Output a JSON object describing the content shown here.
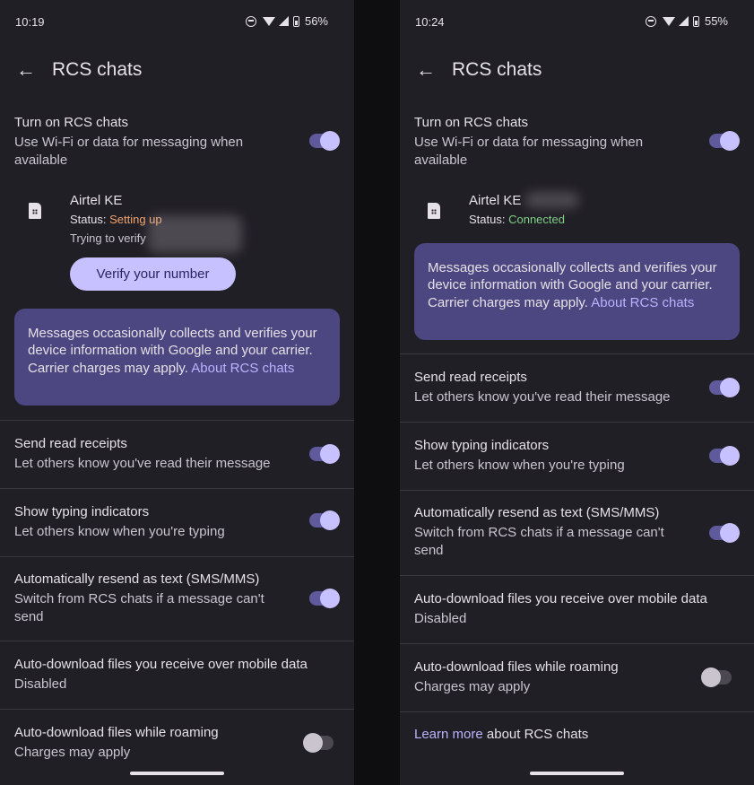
{
  "left": {
    "status_time": "10:19",
    "battery": "56%",
    "header_title": "RCS chats",
    "turn_on": {
      "title": "Turn on RCS chats",
      "subtitle": "Use Wi-Fi or data for messaging when available",
      "enabled": true
    },
    "sim": {
      "carrier": "Airtel KE",
      "status_label": "Status:",
      "status_value": "Setting up",
      "trying": "Trying to verify"
    },
    "verify_button": "Verify your number",
    "info": {
      "text": "Messages occasionally collects and verifies your device information with Google and your carrier. Carrier charges may apply.",
      "link": "About RCS chats"
    },
    "settings": [
      {
        "title": "Send read receipts",
        "subtitle": "Let others know you've read their message",
        "enabled": true
      },
      {
        "title": "Show typing indicators",
        "subtitle": "Let others know when you're typing",
        "enabled": true
      },
      {
        "title": "Automatically resend as text (SMS/MMS)",
        "subtitle": "Switch from RCS chats if a message can't send",
        "enabled": true
      },
      {
        "title": "Auto-download files you receive over mobile data",
        "subtitle": "Disabled"
      },
      {
        "title": "Auto-download files while roaming",
        "subtitle": "Charges may apply",
        "enabled": false
      }
    ]
  },
  "right": {
    "status_time": "10:24",
    "battery": "55%",
    "header_title": "RCS chats",
    "turn_on": {
      "title": "Turn on RCS chats",
      "subtitle": "Use Wi-Fi or data for messaging when available",
      "enabled": true
    },
    "sim": {
      "carrier": "Airtel KE",
      "status_label": "Status:",
      "status_value": "Connected"
    },
    "info": {
      "text": "Messages occasionally collects and verifies your device information with Google and your carrier. Carrier charges may apply.",
      "link": "About RCS chats"
    },
    "settings": [
      {
        "title": "Send read receipts",
        "subtitle": "Let others know you've read their message",
        "enabled": true
      },
      {
        "title": "Show typing indicators",
        "subtitle": "Let others know when you're typing",
        "enabled": true
      },
      {
        "title": "Automatically resend as text (SMS/MMS)",
        "subtitle": "Switch from RCS chats if a message can't send",
        "enabled": true
      },
      {
        "title": "Auto-download files you receive over mobile data",
        "subtitle": "Disabled"
      },
      {
        "title": "Auto-download files while roaming",
        "subtitle": "Charges may apply",
        "enabled": false
      }
    ],
    "learn_more": {
      "link": "Learn more",
      "rest": " about RCS chats"
    }
  },
  "colors": {
    "background": "#211f26",
    "accent": "#c7c1ff",
    "info_card": "#4c4781",
    "setting_up": "#f0a46d",
    "connected": "#7fcf86"
  }
}
